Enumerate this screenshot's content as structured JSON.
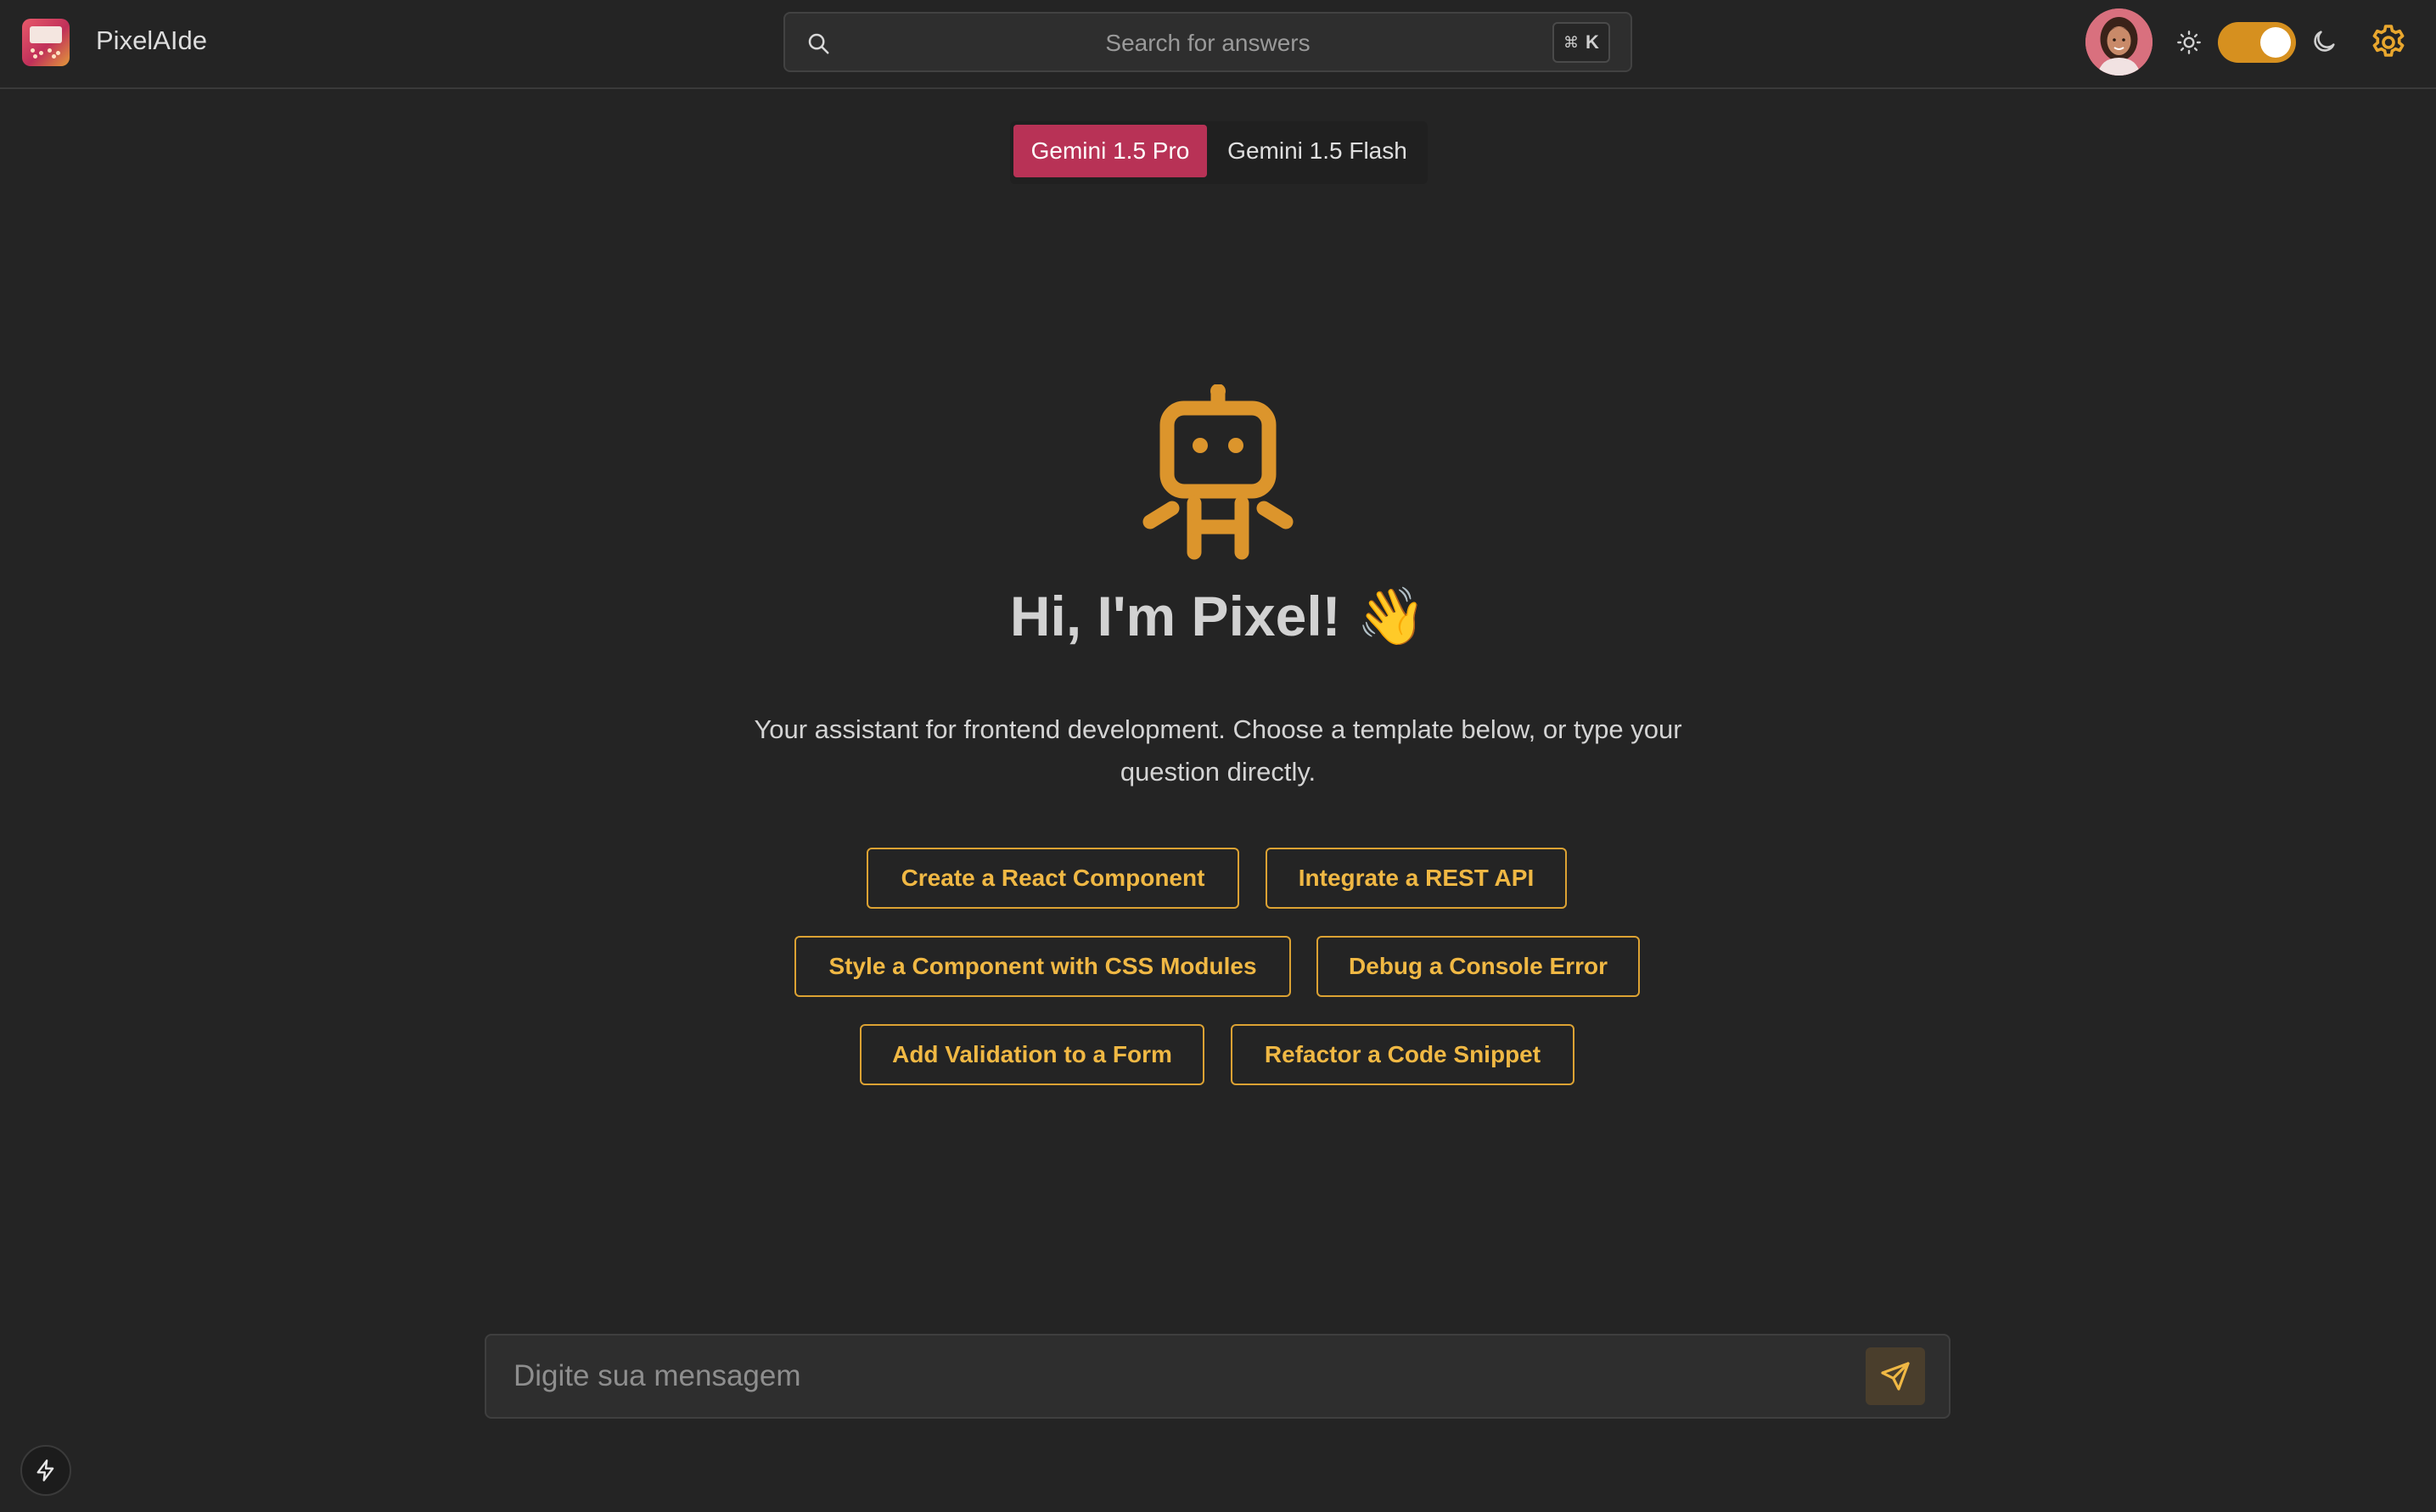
{
  "header": {
    "app_name": "PixelAIde",
    "search": {
      "placeholder": "Search for answers",
      "shortcut_symbol": "⌘",
      "shortcut_key": "K"
    },
    "theme_toggle": {
      "mode": "dark",
      "on": true
    }
  },
  "model_switch": {
    "options": [
      {
        "label": "Gemini 1.5 Pro",
        "selected": true
      },
      {
        "label": "Gemini 1.5 Flash",
        "selected": false
      }
    ]
  },
  "hero": {
    "title": "Hi, I'm Pixel! 👋",
    "subtitle": "Your assistant for frontend development. Choose a template below, or type your question directly."
  },
  "templates": [
    {
      "label": "Create a React Component"
    },
    {
      "label": "Integrate a REST API"
    },
    {
      "label": "Style a Component with CSS Modules"
    },
    {
      "label": "Debug a Console Error"
    },
    {
      "label": "Add Validation to a Form"
    },
    {
      "label": "Refactor a Code Snippet"
    }
  ],
  "composer": {
    "placeholder": "Digite sua mensagem"
  },
  "icons": {
    "search": "search-icon",
    "sun": "sun-icon",
    "moon": "moon-icon",
    "settings": "gear-icon",
    "robot": "robot-icon",
    "send": "send-icon",
    "bolt": "lightning-icon"
  },
  "colors": {
    "background": "#242424",
    "accent": "#f0b844",
    "primary": "#b83256",
    "toggle": "#d6901f"
  }
}
